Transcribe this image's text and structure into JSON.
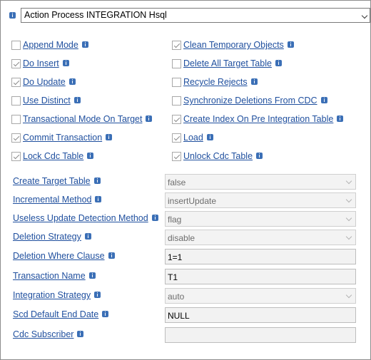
{
  "action_select": {
    "value": "Action Process INTEGRATION Hsql"
  },
  "checkboxes": [
    {
      "label": "Append Mode",
      "checked": false
    },
    {
      "label": "Clean Temporary Objects",
      "checked": true
    },
    {
      "label": "Do Insert",
      "checked": true
    },
    {
      "label": "Delete All Target Table",
      "checked": false
    },
    {
      "label": "Do Update",
      "checked": true
    },
    {
      "label": "Recycle Rejects",
      "checked": false
    },
    {
      "label": "Use Distinct",
      "checked": false
    },
    {
      "label": "Synchronize Deletions From CDC",
      "checked": false
    },
    {
      "label": "Transactional Mode On Target",
      "checked": false
    },
    {
      "label": "Create Index On Pre Integration Table",
      "checked": true
    },
    {
      "label": "Commit Transaction",
      "checked": true
    },
    {
      "label": "Load",
      "checked": true
    },
    {
      "label": "Lock Cdc Table",
      "checked": true
    },
    {
      "label": "Unlock Cdc Table",
      "checked": true
    }
  ],
  "fields": [
    {
      "label": "Create Target Table",
      "value": "false",
      "type": "select"
    },
    {
      "label": "Incremental Method",
      "value": "insertUpdate",
      "type": "select"
    },
    {
      "label": "Useless Update Detection Method",
      "value": "flag",
      "type": "select"
    },
    {
      "label": "Deletion Strategy",
      "value": "disable",
      "type": "select"
    },
    {
      "label": "Deletion Where Clause",
      "value": "1=1",
      "type": "text"
    },
    {
      "label": "Transaction Name",
      "value": "T1",
      "type": "text"
    },
    {
      "label": "Integration Strategy",
      "value": "auto",
      "type": "select"
    },
    {
      "label": "Scd Default End Date",
      "value": "NULL",
      "type": "text"
    },
    {
      "label": "Cdc Subscriber",
      "value": "",
      "type": "text"
    }
  ]
}
